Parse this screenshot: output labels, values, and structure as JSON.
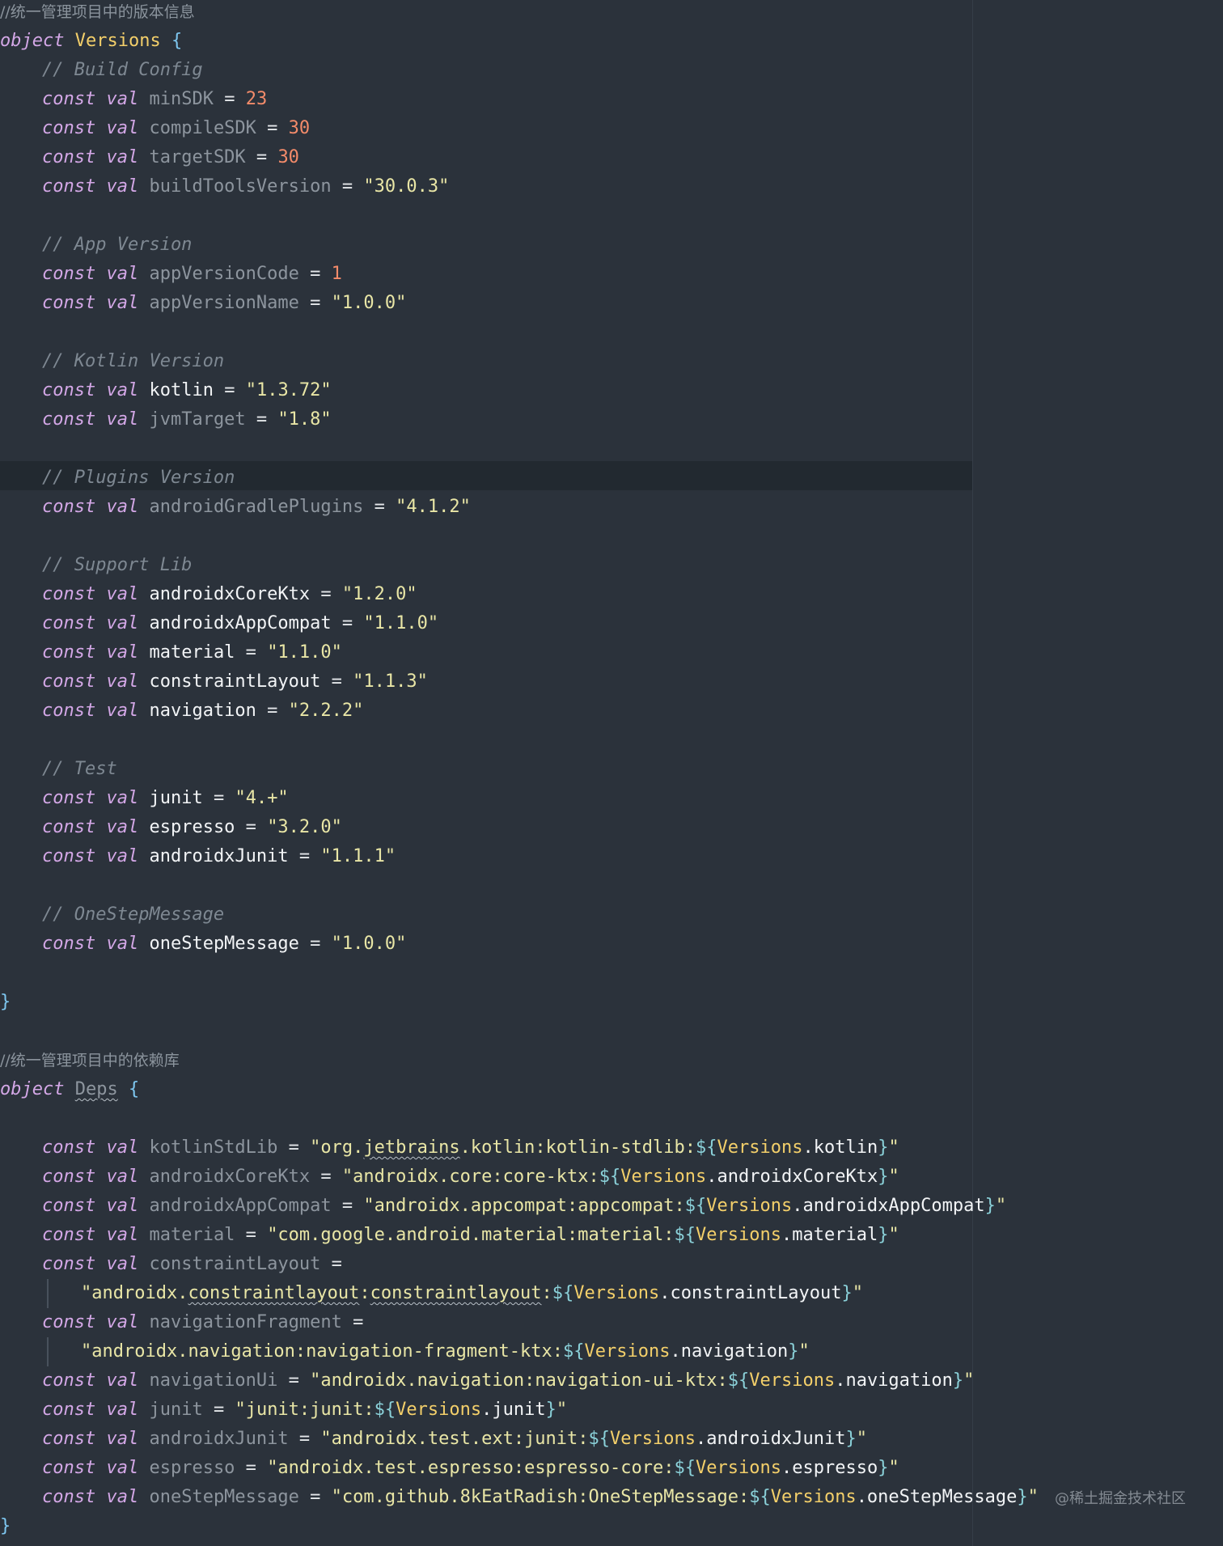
{
  "colors": {
    "background": "#2b323b",
    "keyword": "#d3a7e6",
    "comment": "#7e8892",
    "class_name": "#f3cf6a",
    "unused_property": "#8d959e",
    "identifier": "#f2f4f6",
    "number": "#f38b6a",
    "string": "#e9e6a6",
    "template": "#8ad0d8",
    "brace": "#7ec7f0"
  },
  "watermark": "@稀土掘金技术社区",
  "lines": [
    {
      "indent": 0,
      "tokens": [
        {
          "t": "//统一管理项目中的版本信息",
          "c": "cmt-cjk"
        }
      ]
    },
    {
      "indent": 0,
      "tokens": [
        {
          "t": "object",
          "c": "kw"
        },
        {
          "t": " ",
          "c": "punc"
        },
        {
          "t": "Versions",
          "c": "cls"
        },
        {
          "t": " ",
          "c": "punc"
        },
        {
          "t": "{",
          "c": "brace"
        }
      ]
    },
    {
      "indent": 1,
      "tokens": [
        {
          "t": "// Build Config",
          "c": "cmt"
        }
      ]
    },
    {
      "indent": 1,
      "tokens": [
        {
          "t": "const val",
          "c": "kw"
        },
        {
          "t": " ",
          "c": "punc"
        },
        {
          "t": "minSDK",
          "c": "prop"
        },
        {
          "t": " = ",
          "c": "punc"
        },
        {
          "t": "23",
          "c": "num"
        }
      ]
    },
    {
      "indent": 1,
      "tokens": [
        {
          "t": "const val",
          "c": "kw"
        },
        {
          "t": " ",
          "c": "punc"
        },
        {
          "t": "compileSDK",
          "c": "prop"
        },
        {
          "t": " = ",
          "c": "punc"
        },
        {
          "t": "30",
          "c": "num"
        }
      ]
    },
    {
      "indent": 1,
      "tokens": [
        {
          "t": "const val",
          "c": "kw"
        },
        {
          "t": " ",
          "c": "punc"
        },
        {
          "t": "targetSDK",
          "c": "prop"
        },
        {
          "t": " = ",
          "c": "punc"
        },
        {
          "t": "30",
          "c": "num"
        }
      ]
    },
    {
      "indent": 1,
      "tokens": [
        {
          "t": "const val",
          "c": "kw"
        },
        {
          "t": " ",
          "c": "punc"
        },
        {
          "t": "buildToolsVersion",
          "c": "prop"
        },
        {
          "t": " = ",
          "c": "punc"
        },
        {
          "t": "\"30.0.3\"",
          "c": "str"
        }
      ]
    },
    {
      "indent": 0,
      "tokens": []
    },
    {
      "indent": 1,
      "tokens": [
        {
          "t": "// App Version",
          "c": "cmt"
        }
      ]
    },
    {
      "indent": 1,
      "tokens": [
        {
          "t": "const val",
          "c": "kw"
        },
        {
          "t": " ",
          "c": "punc"
        },
        {
          "t": "appVersionCode",
          "c": "prop"
        },
        {
          "t": " = ",
          "c": "punc"
        },
        {
          "t": "1",
          "c": "num"
        }
      ]
    },
    {
      "indent": 1,
      "tokens": [
        {
          "t": "const val",
          "c": "kw"
        },
        {
          "t": " ",
          "c": "punc"
        },
        {
          "t": "appVersionName",
          "c": "prop"
        },
        {
          "t": " = ",
          "c": "punc"
        },
        {
          "t": "\"1.0.0\"",
          "c": "str"
        }
      ]
    },
    {
      "indent": 0,
      "tokens": []
    },
    {
      "indent": 1,
      "tokens": [
        {
          "t": "// Kotlin Version",
          "c": "cmt"
        }
      ]
    },
    {
      "indent": 1,
      "tokens": [
        {
          "t": "const val",
          "c": "kw"
        },
        {
          "t": " ",
          "c": "punc"
        },
        {
          "t": "kotlin",
          "c": "id"
        },
        {
          "t": " = ",
          "c": "punc"
        },
        {
          "t": "\"1.3.72\"",
          "c": "str"
        }
      ]
    },
    {
      "indent": 1,
      "tokens": [
        {
          "t": "const val",
          "c": "kw"
        },
        {
          "t": " ",
          "c": "punc"
        },
        {
          "t": "jvmTarget",
          "c": "prop"
        },
        {
          "t": " = ",
          "c": "punc"
        },
        {
          "t": "\"1.8\"",
          "c": "str"
        }
      ]
    },
    {
      "indent": 0,
      "tokens": []
    },
    {
      "indent": 1,
      "tokens": [
        {
          "t": "// Plugins Version",
          "c": "cmt"
        }
      ]
    },
    {
      "indent": 1,
      "tokens": [
        {
          "t": "const val",
          "c": "kw"
        },
        {
          "t": " ",
          "c": "punc"
        },
        {
          "t": "androidGradlePlugins",
          "c": "prop"
        },
        {
          "t": " = ",
          "c": "punc"
        },
        {
          "t": "\"4.1.2\"",
          "c": "str"
        }
      ]
    },
    {
      "indent": 0,
      "tokens": []
    },
    {
      "indent": 1,
      "tokens": [
        {
          "t": "// Support Lib",
          "c": "cmt"
        }
      ]
    },
    {
      "indent": 1,
      "tokens": [
        {
          "t": "const val",
          "c": "kw"
        },
        {
          "t": " ",
          "c": "punc"
        },
        {
          "t": "androidxCoreKtx",
          "c": "id"
        },
        {
          "t": " = ",
          "c": "punc"
        },
        {
          "t": "\"1.2.0\"",
          "c": "str"
        }
      ]
    },
    {
      "indent": 1,
      "tokens": [
        {
          "t": "const val",
          "c": "kw"
        },
        {
          "t": " ",
          "c": "punc"
        },
        {
          "t": "androidxAppCompat",
          "c": "id"
        },
        {
          "t": " = ",
          "c": "punc"
        },
        {
          "t": "\"1.1.0\"",
          "c": "str"
        }
      ]
    },
    {
      "indent": 1,
      "tokens": [
        {
          "t": "const val",
          "c": "kw"
        },
        {
          "t": " ",
          "c": "punc"
        },
        {
          "t": "material",
          "c": "id"
        },
        {
          "t": " = ",
          "c": "punc"
        },
        {
          "t": "\"1.1.0\"",
          "c": "str"
        }
      ]
    },
    {
      "indent": 1,
      "tokens": [
        {
          "t": "const val",
          "c": "kw"
        },
        {
          "t": " ",
          "c": "punc"
        },
        {
          "t": "constraintLayout",
          "c": "id"
        },
        {
          "t": " = ",
          "c": "punc"
        },
        {
          "t": "\"1.1.3\"",
          "c": "str"
        }
      ]
    },
    {
      "indent": 1,
      "tokens": [
        {
          "t": "const val",
          "c": "kw"
        },
        {
          "t": " ",
          "c": "punc"
        },
        {
          "t": "navigation",
          "c": "id"
        },
        {
          "t": " = ",
          "c": "punc"
        },
        {
          "t": "\"2.2.2\"",
          "c": "str"
        }
      ]
    },
    {
      "indent": 0,
      "tokens": []
    },
    {
      "indent": 1,
      "tokens": [
        {
          "t": "// Test",
          "c": "cmt"
        }
      ]
    },
    {
      "indent": 1,
      "tokens": [
        {
          "t": "const val",
          "c": "kw"
        },
        {
          "t": " ",
          "c": "punc"
        },
        {
          "t": "junit",
          "c": "id"
        },
        {
          "t": " = ",
          "c": "punc"
        },
        {
          "t": "\"4.+\"",
          "c": "str"
        }
      ]
    },
    {
      "indent": 1,
      "tokens": [
        {
          "t": "const val",
          "c": "kw"
        },
        {
          "t": " ",
          "c": "punc"
        },
        {
          "t": "espresso",
          "c": "id"
        },
        {
          "t": " = ",
          "c": "punc"
        },
        {
          "t": "\"3.2.0\"",
          "c": "str"
        }
      ]
    },
    {
      "indent": 1,
      "tokens": [
        {
          "t": "const val",
          "c": "kw"
        },
        {
          "t": " ",
          "c": "punc"
        },
        {
          "t": "androidxJunit",
          "c": "id"
        },
        {
          "t": " = ",
          "c": "punc"
        },
        {
          "t": "\"1.1.1\"",
          "c": "str"
        }
      ]
    },
    {
      "indent": 0,
      "tokens": []
    },
    {
      "indent": 1,
      "tokens": [
        {
          "t": "// OneStepMessage",
          "c": "cmt"
        }
      ]
    },
    {
      "indent": 1,
      "tokens": [
        {
          "t": "const val",
          "c": "kw"
        },
        {
          "t": " ",
          "c": "punc"
        },
        {
          "t": "oneStepMessage",
          "c": "id"
        },
        {
          "t": " = ",
          "c": "punc"
        },
        {
          "t": "\"1.0.0\"",
          "c": "str"
        }
      ]
    },
    {
      "indent": 0,
      "tokens": []
    },
    {
      "indent": 0,
      "tokens": [
        {
          "t": "}",
          "c": "brace"
        }
      ]
    },
    {
      "indent": 0,
      "tokens": []
    },
    {
      "indent": 0,
      "tokens": [
        {
          "t": "//统一管理项目中的依赖库",
          "c": "cmt-cjk"
        }
      ]
    },
    {
      "indent": 0,
      "tokens": [
        {
          "t": "object",
          "c": "kw"
        },
        {
          "t": " ",
          "c": "punc"
        },
        {
          "t": "Deps",
          "c": "prop",
          "sq": true
        },
        {
          "t": " ",
          "c": "punc"
        },
        {
          "t": "{",
          "c": "brace"
        }
      ]
    },
    {
      "indent": 0,
      "tokens": []
    },
    {
      "indent": 1,
      "tokens": [
        {
          "t": "const val",
          "c": "kw"
        },
        {
          "t": " ",
          "c": "punc"
        },
        {
          "t": "kotlinStdLib",
          "c": "prop"
        },
        {
          "t": " = ",
          "c": "punc"
        },
        {
          "t": "\"org.",
          "c": "str"
        },
        {
          "t": "jetbrains",
          "c": "str",
          "sq": true
        },
        {
          "t": ".kotlin:kotlin-stdlib:",
          "c": "str"
        },
        {
          "t": "${",
          "c": "tpl"
        },
        {
          "t": "Versions",
          "c": "cls"
        },
        {
          "t": ".kotlin",
          "c": "id"
        },
        {
          "t": "}",
          "c": "tpl"
        },
        {
          "t": "\"",
          "c": "str"
        }
      ]
    },
    {
      "indent": 1,
      "tokens": [
        {
          "t": "const val",
          "c": "kw"
        },
        {
          "t": " ",
          "c": "punc"
        },
        {
          "t": "androidxCoreKtx",
          "c": "prop"
        },
        {
          "t": " = ",
          "c": "punc"
        },
        {
          "t": "\"androidx.core:core-ktx:",
          "c": "str"
        },
        {
          "t": "${",
          "c": "tpl"
        },
        {
          "t": "Versions",
          "c": "cls"
        },
        {
          "t": ".androidxCoreKtx",
          "c": "id"
        },
        {
          "t": "}",
          "c": "tpl"
        },
        {
          "t": "\"",
          "c": "str"
        }
      ]
    },
    {
      "indent": 1,
      "tokens": [
        {
          "t": "const val",
          "c": "kw"
        },
        {
          "t": " ",
          "c": "punc"
        },
        {
          "t": "androidxAppCompat",
          "c": "prop"
        },
        {
          "t": " = ",
          "c": "punc"
        },
        {
          "t": "\"androidx.appcompat:appcompat:",
          "c": "str"
        },
        {
          "t": "${",
          "c": "tpl"
        },
        {
          "t": "Versions",
          "c": "cls"
        },
        {
          "t": ".androidxAppCompat",
          "c": "id"
        },
        {
          "t": "}",
          "c": "tpl"
        },
        {
          "t": "\"",
          "c": "str"
        }
      ]
    },
    {
      "indent": 1,
      "tokens": [
        {
          "t": "const val",
          "c": "kw"
        },
        {
          "t": " ",
          "c": "punc"
        },
        {
          "t": "material",
          "c": "prop"
        },
        {
          "t": " = ",
          "c": "punc"
        },
        {
          "t": "\"com.google.android.material:material:",
          "c": "str"
        },
        {
          "t": "${",
          "c": "tpl"
        },
        {
          "t": "Versions",
          "c": "cls"
        },
        {
          "t": ".material",
          "c": "id"
        },
        {
          "t": "}",
          "c": "tpl"
        },
        {
          "t": "\"",
          "c": "str"
        }
      ]
    },
    {
      "indent": 1,
      "tokens": [
        {
          "t": "const val",
          "c": "kw"
        },
        {
          "t": " ",
          "c": "punc"
        },
        {
          "t": "constraintLayout",
          "c": "prop"
        },
        {
          "t": " =",
          "c": "punc"
        }
      ]
    },
    {
      "indent": 2,
      "cont": true,
      "tokens": [
        {
          "t": "\"androidx.",
          "c": "str"
        },
        {
          "t": "constraintlayout",
          "c": "str",
          "sq": true
        },
        {
          "t": ":",
          "c": "str"
        },
        {
          "t": "constraintlayout",
          "c": "str",
          "sq": true
        },
        {
          "t": ":",
          "c": "str"
        },
        {
          "t": "${",
          "c": "tpl"
        },
        {
          "t": "Versions",
          "c": "cls"
        },
        {
          "t": ".constraintLayout",
          "c": "id"
        },
        {
          "t": "}",
          "c": "tpl"
        },
        {
          "t": "\"",
          "c": "str"
        }
      ]
    },
    {
      "indent": 1,
      "tokens": [
        {
          "t": "const val",
          "c": "kw"
        },
        {
          "t": " ",
          "c": "punc"
        },
        {
          "t": "navigationFragment",
          "c": "prop"
        },
        {
          "t": " =",
          "c": "punc"
        }
      ]
    },
    {
      "indent": 2,
      "cont": true,
      "tokens": [
        {
          "t": "\"androidx.navigation:navigation-fragment-ktx:",
          "c": "str"
        },
        {
          "t": "${",
          "c": "tpl"
        },
        {
          "t": "Versions",
          "c": "cls"
        },
        {
          "t": ".navigation",
          "c": "id"
        },
        {
          "t": "}",
          "c": "tpl"
        },
        {
          "t": "\"",
          "c": "str"
        }
      ]
    },
    {
      "indent": 1,
      "tokens": [
        {
          "t": "const val",
          "c": "kw"
        },
        {
          "t": " ",
          "c": "punc"
        },
        {
          "t": "navigationUi",
          "c": "prop"
        },
        {
          "t": " = ",
          "c": "punc"
        },
        {
          "t": "\"androidx.navigation:navigation-ui-ktx:",
          "c": "str"
        },
        {
          "t": "${",
          "c": "tpl"
        },
        {
          "t": "Versions",
          "c": "cls"
        },
        {
          "t": ".navigation",
          "c": "id"
        },
        {
          "t": "}",
          "c": "tpl"
        },
        {
          "t": "\"",
          "c": "str"
        }
      ]
    },
    {
      "indent": 1,
      "tokens": [
        {
          "t": "const val",
          "c": "kw"
        },
        {
          "t": " ",
          "c": "punc"
        },
        {
          "t": "junit",
          "c": "prop"
        },
        {
          "t": " = ",
          "c": "punc"
        },
        {
          "t": "\"junit:junit:",
          "c": "str"
        },
        {
          "t": "${",
          "c": "tpl"
        },
        {
          "t": "Versions",
          "c": "cls"
        },
        {
          "t": ".junit",
          "c": "id"
        },
        {
          "t": "}",
          "c": "tpl"
        },
        {
          "t": "\"",
          "c": "str"
        }
      ]
    },
    {
      "indent": 1,
      "tokens": [
        {
          "t": "const val",
          "c": "kw"
        },
        {
          "t": " ",
          "c": "punc"
        },
        {
          "t": "androidxJunit",
          "c": "prop"
        },
        {
          "t": " = ",
          "c": "punc"
        },
        {
          "t": "\"androidx.test.ext:junit:",
          "c": "str"
        },
        {
          "t": "${",
          "c": "tpl"
        },
        {
          "t": "Versions",
          "c": "cls"
        },
        {
          "t": ".androidxJunit",
          "c": "id"
        },
        {
          "t": "}",
          "c": "tpl"
        },
        {
          "t": "\"",
          "c": "str"
        }
      ]
    },
    {
      "indent": 1,
      "tokens": [
        {
          "t": "const val",
          "c": "kw"
        },
        {
          "t": " ",
          "c": "punc"
        },
        {
          "t": "espresso",
          "c": "prop"
        },
        {
          "t": " = ",
          "c": "punc"
        },
        {
          "t": "\"androidx.test.espresso:espresso-core:",
          "c": "str"
        },
        {
          "t": "${",
          "c": "tpl"
        },
        {
          "t": "Versions",
          "c": "cls"
        },
        {
          "t": ".espresso",
          "c": "id"
        },
        {
          "t": "}",
          "c": "tpl"
        },
        {
          "t": "\"",
          "c": "str"
        }
      ]
    },
    {
      "indent": 1,
      "tokens": [
        {
          "t": "const val",
          "c": "kw"
        },
        {
          "t": " ",
          "c": "punc"
        },
        {
          "t": "oneStepMessage",
          "c": "prop"
        },
        {
          "t": " = ",
          "c": "punc"
        },
        {
          "t": "\"com.github.8kEatRadish:OneStepMessage:",
          "c": "str"
        },
        {
          "t": "${",
          "c": "tpl"
        },
        {
          "t": "Versions",
          "c": "cls"
        },
        {
          "t": ".oneStepMessage",
          "c": "id"
        },
        {
          "t": "}",
          "c": "tpl"
        },
        {
          "t": "\"",
          "c": "str"
        }
      ]
    },
    {
      "indent": 0,
      "tokens": [
        {
          "t": "}",
          "c": "brace"
        }
      ]
    }
  ]
}
